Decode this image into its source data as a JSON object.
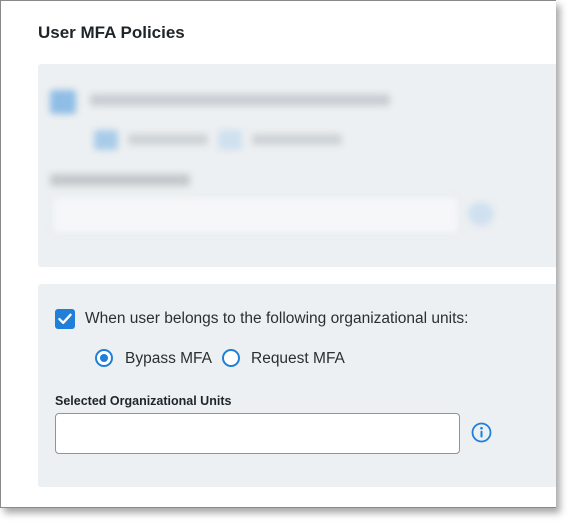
{
  "section": {
    "title": "User MFA Policies"
  },
  "org_units": {
    "checkbox_checked": true,
    "checkbox_label": "When user belongs to the following organizational units:",
    "options": [
      {
        "label": "Bypass MFA",
        "selected": true
      },
      {
        "label": "Request MFA",
        "selected": false
      }
    ],
    "field_label": "Selected Organizational Units",
    "field_value": "",
    "info_icon": "info-icon"
  },
  "colors": {
    "accent": "#1f7fd9",
    "panel_bg": "#edf0f2",
    "text": "#2a2f33"
  }
}
